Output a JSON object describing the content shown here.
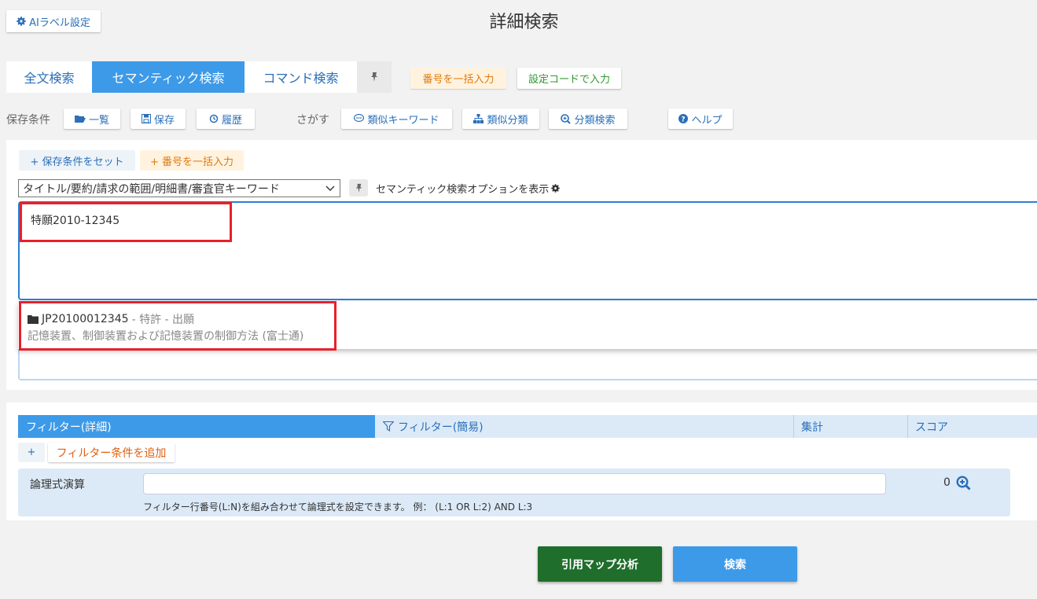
{
  "header": {
    "ai_label_button": "AIラベル設定",
    "title": "詳細検索"
  },
  "tabs": [
    {
      "label": "全文検索"
    },
    {
      "label": "セマンティック検索"
    },
    {
      "label": "コマンド検索"
    }
  ],
  "quick_actions": {
    "batch_number_input": "番号を一括入力",
    "setting_code_input": "設定コードで入力"
  },
  "toolbar": {
    "saved_conditions_label": "保存条件",
    "list": "一覧",
    "save": "保存",
    "history": "履歴",
    "search_label": "さがす",
    "similar_keyword": "類似キーワード",
    "similar_class": "類似分類",
    "class_search": "分類検索",
    "help": "ヘルプ"
  },
  "search_panel": {
    "set_saved_condition": "+ 保存条件をセット",
    "batch_number_input": "+ 番号を一括入力",
    "field_select": "タイトル/要約/請求の範囲/明細書/審査官キーワード",
    "semantic_option": "セマンティック検索オプションを表示",
    "query": "特願2010-12345",
    "suggestion": {
      "number": "JP20100012345",
      "meta": "- 特許 - 出願",
      "title": "記憶装置、制御装置および記憶装置の制御方法 (富士通)"
    }
  },
  "filter_panel": {
    "tabs": [
      {
        "label": "フィルター(詳細)"
      },
      {
        "label": "フィルター(簡易)"
      },
      {
        "label": "集計"
      },
      {
        "label": "スコア"
      }
    ],
    "add_plus": "+",
    "add_filter": "フィルター条件を追加",
    "logic_label": "論理式演算",
    "logic_value": "",
    "logic_help": "フィルター行番号(L:N)を組み合わせて論理式を設定できます。  例： (L:1 OR L:2) AND L:3",
    "logic_count": "0"
  },
  "actions": {
    "citation_map": "引用マップ分析",
    "search": "検索"
  },
  "colors": {
    "accent": "#3d9ae8",
    "highlight": "#e8202a",
    "citation_button": "#1f6e2c"
  }
}
